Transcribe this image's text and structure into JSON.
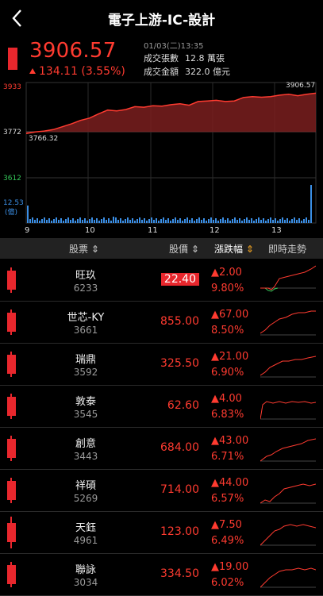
{
  "header": {
    "title": "電子上游-IC-設計"
  },
  "quote": {
    "price": "3906.57",
    "change": "134.11 (3.55%)",
    "datetime": "01/03(二)13:35",
    "volume_label": "成交張數",
    "volume_value": "12.8 萬張",
    "amount_label": "成交金額",
    "amount_value": "322.0 億元"
  },
  "chart": {
    "y_high": "3933",
    "y_prev": "3772",
    "y_low": "3612",
    "open_value": "3766.32",
    "last_value": "3906.57",
    "vol_max": "12.53",
    "vol_unit": "(億)",
    "x_ticks": [
      "9",
      "10",
      "11",
      "12",
      "13"
    ]
  },
  "chart_data": {
    "type": "line",
    "x_ticks": [
      "9",
      "10",
      "11",
      "12",
      "13"
    ],
    "ylim": [
      3612,
      3933
    ],
    "reference": 3772,
    "series": [
      {
        "values": [
          3766,
          3772,
          3775,
          3780,
          3790,
          3800,
          3812,
          3820,
          3835,
          3848,
          3845,
          3850,
          3860,
          3858,
          3863,
          3862,
          3867,
          3870,
          3865,
          3878,
          3880,
          3882,
          3878,
          3880,
          3892,
          3895,
          3893,
          3895,
          3900,
          3903,
          3898,
          3903,
          3907
        ]
      }
    ]
  },
  "table": {
    "headers": {
      "stock": "股票",
      "price": "股價",
      "change": "漲跌幅",
      "trend": "即時走勢"
    },
    "rows": [
      {
        "name": "旺玖",
        "code": "6233",
        "price": "22.40",
        "change": "2.00",
        "pct": "9.80%"
      },
      {
        "name": "世芯-KY",
        "code": "3661",
        "price": "855.00",
        "change": "67.00",
        "pct": "8.50%"
      },
      {
        "name": "瑞鼎",
        "code": "3592",
        "price": "325.50",
        "change": "21.00",
        "pct": "6.90%"
      },
      {
        "name": "敦泰",
        "code": "3545",
        "price": "62.60",
        "change": "4.00",
        "pct": "6.83%"
      },
      {
        "name": "創意",
        "code": "3443",
        "price": "684.00",
        "change": "43.00",
        "pct": "6.71%"
      },
      {
        "name": "祥碩",
        "code": "5269",
        "price": "714.00",
        "change": "44.00",
        "pct": "6.57%"
      },
      {
        "name": "天鈺",
        "code": "4961",
        "price": "123.00",
        "change": "7.50",
        "pct": "6.49%"
      },
      {
        "name": "聯詠",
        "code": "3034",
        "price": "334.50",
        "change": "19.00",
        "pct": "6.02%"
      }
    ]
  },
  "colors": {
    "up": "#ff3b30",
    "down": "#34c759",
    "header_highlight": "#f5a623"
  }
}
